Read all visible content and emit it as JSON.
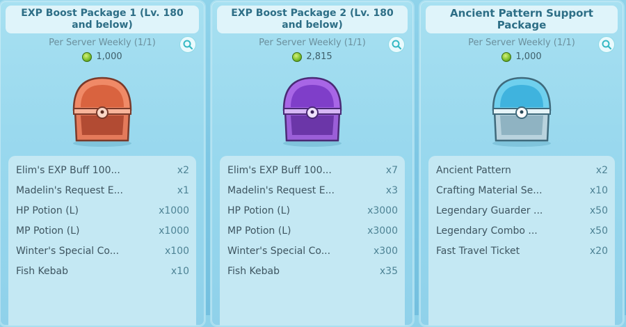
{
  "packages": [
    {
      "title": "EXP Boost Package 1 (Lv. 180 and below)",
      "frequency": "Per Server Weekly (1/1)",
      "price": "1,000",
      "chest_color": "coral",
      "items": [
        {
          "name": "Elim's EXP Buff 100...",
          "qty": "x2"
        },
        {
          "name": "Madelin's Request E...",
          "qty": "x1"
        },
        {
          "name": "HP Potion (L)",
          "qty": "x1000"
        },
        {
          "name": "MP Potion (L)",
          "qty": "x1000"
        },
        {
          "name": "Winter's Special Co...",
          "qty": "x100"
        },
        {
          "name": "Fish Kebab",
          "qty": "x10"
        }
      ]
    },
    {
      "title": "EXP Boost Package 2 (Lv. 180 and below)",
      "frequency": "Per Server Weekly (1/1)",
      "price": "2,815",
      "chest_color": "purple",
      "items": [
        {
          "name": "Elim's EXP Buff 100...",
          "qty": "x7"
        },
        {
          "name": "Madelin's Request E...",
          "qty": "x3"
        },
        {
          "name": "HP Potion (L)",
          "qty": "x3000"
        },
        {
          "name": "MP Potion (L)",
          "qty": "x3000"
        },
        {
          "name": "Winter's Special Co...",
          "qty": "x300"
        },
        {
          "name": "Fish Kebab",
          "qty": "x35"
        }
      ]
    },
    {
      "title": "Ancient Pattern Support Package",
      "frequency": "Per Server Weekly (1/1)",
      "price": "1,000",
      "chest_color": "light-blue",
      "items": [
        {
          "name": "Ancient Pattern",
          "qty": "x2"
        },
        {
          "name": "Crafting Material Se...",
          "qty": "x10"
        },
        {
          "name": "Legendary Guarder ...",
          "qty": "x50"
        },
        {
          "name": "Legendary Combo ...",
          "qty": "x50"
        },
        {
          "name": "Fast Travel Ticket",
          "qty": "x20"
        }
      ]
    }
  ],
  "icons": {
    "search": "magnifier-icon",
    "currency": "green-gem-coin-icon",
    "chest": "treasure-chest-icon"
  },
  "colors": {
    "title_text": "#2d6e86",
    "qty_text": "#4e8395",
    "chest_coral": "#f08a67",
    "chest_purple": "#a866e6",
    "chest_light_blue": "#6fd0ee"
  }
}
